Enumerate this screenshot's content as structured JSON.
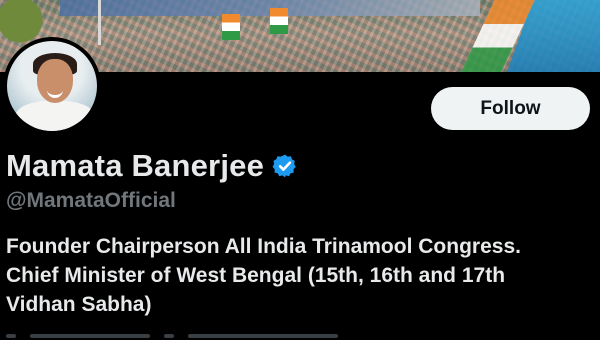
{
  "profile": {
    "display_name": "Mamata Banerjee",
    "handle": "@MamataOfficial",
    "verified": true,
    "bio_lines": [
      "Founder Chairperson All India Trinamool Congress.",
      "Chief Minister of West Bengal (15th, 16th and 17th",
      "Vidhan Sabha)"
    ]
  },
  "actions": {
    "follow_label": "Follow"
  },
  "colors": {
    "background": "#000000",
    "primary_text": "#e7e9ea",
    "secondary_text": "#71767b",
    "button_bg": "#eff3f4",
    "verified_blue": "#1d9bf0"
  },
  "icons": {
    "verified": "verified-badge-icon"
  }
}
